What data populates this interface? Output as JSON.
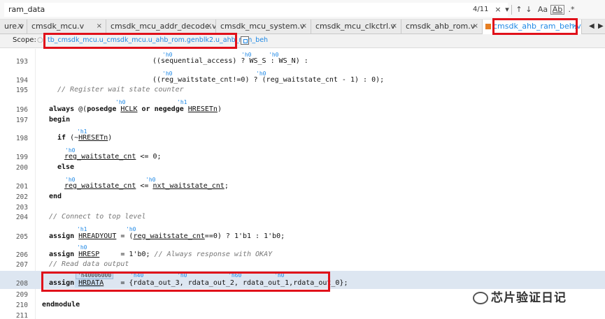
{
  "findbar": {
    "query": "ram_data",
    "match_count": "4/11",
    "close_glyph": "×",
    "dropdown_glyph": "▾",
    "prev_glyph": "↑",
    "next_glyph": "↓",
    "case_label": "Aa",
    "word_label": "Ab",
    "regex_label": ".*"
  },
  "tabs": [
    {
      "label": "ure.v",
      "close": "×"
    },
    {
      "label": "cmsdk_mcu.v",
      "close": "×"
    },
    {
      "label": "cmsdk_mcu_addr_decode.v",
      "close": "×"
    },
    {
      "label": "cmsdk_mcu_system.v",
      "close": "×"
    },
    {
      "label": "cmsdk_mcu_clkctrl.v",
      "close": "×"
    },
    {
      "label": "cmsdk_ahb_rom.v",
      "close": "×"
    },
    {
      "label": "cmsdk_ahb_ram_beh.v",
      "close": "×",
      "active": true
    }
  ],
  "tab_nav": {
    "left": "◀",
    "right": "▶"
  },
  "scope": {
    "label": "Scope:",
    "path": "tb_cmsdk_mcu.u_cmsdk_mcu.u_ahb_rom.genblk2.u_ahb_ram_beh"
  },
  "editor": {
    "lines": [
      {
        "num": "193",
        "ann": [
          {
            "text": "'h0",
            "col": 0
          },
          {
            "text": "'h0",
            "col": 1
          },
          {
            "text": "'h0",
            "col": 2
          }
        ]
      },
      {
        "num": "194"
      },
      {
        "num": "195"
      },
      {
        "num": "196"
      },
      {
        "num": "197"
      },
      {
        "num": "198"
      },
      {
        "num": "199"
      },
      {
        "num": "200"
      },
      {
        "num": "201"
      },
      {
        "num": "202"
      },
      {
        "num": "203"
      },
      {
        "num": "204"
      },
      {
        "num": "205"
      },
      {
        "num": "206"
      },
      {
        "num": "207"
      },
      {
        "num": "208"
      },
      {
        "num": "209"
      },
      {
        "num": "210"
      },
      {
        "num": "211"
      }
    ],
    "code": {
      "l193": "((sequential_access) ? WS_S : WS_N) :",
      "l194": "((reg_waitstate_cnt!=0) ? (reg_waitstate_cnt - 1) : 0);",
      "l195": "// Register wait state counter",
      "l196_kw1": "always",
      "l196_a": "@(",
      "l196_kw2": "posedge",
      "l196_s1": "HCLK",
      "l196_kw3": "or",
      "l196_kw4": "negedge",
      "l196_s2": "HRESETn",
      "l196_b": ")",
      "l197": "begin",
      "l198_kw": "if",
      "l198_a": "(~",
      "l198_s": "HRESETn",
      "l198_b": ")",
      "l199_s": "reg_waitstate_cnt",
      "l199_b": " <= 0;",
      "l200": "else",
      "l201_s1": "reg_waitstate_cnt",
      "l201_a": " <= ",
      "l201_s2": "nxt_waitstate_cnt",
      "l201_b": ";",
      "l202": "end",
      "l204": "// Connect to top level",
      "l205_kw": "assign",
      "l205_s1": "HREADYOUT",
      "l205_a": " = (",
      "l205_s2": "reg_waitstate_cnt",
      "l205_b": "==0) ? 1'b1 : 1'b0;",
      "l206_kw": "assign",
      "l206_s": "HRESP",
      "l206_a": "     = 1'b0; ",
      "l206_cm": "// Always response with OKAY",
      "l207": "// Read data output",
      "l208_kw": "assign",
      "l208_s": "HRDATA",
      "l208_a": "    = {rdata_out_3, rdata_out_2, rdata_out_1,rdata_out_0};",
      "l210": "endmodule"
    },
    "annotations": {
      "a193_1": "'h0",
      "a193_2": "'h0",
      "a193_3": "'h0",
      "a194_1": "'h0",
      "a194_2": "'h0",
      "a196_1": "'h0",
      "a196_2": "'h1",
      "a198": "'h1",
      "a199": "'h0",
      "a201_1": "'h0",
      "a201_2": "'h0",
      "a205_1": "'h1",
      "a205_2": "'h0",
      "a206": "'h0",
      "a208_box": "'h40006000",
      "a208_1": "'h40",
      "a208_2": "'h0",
      "a208_3": "'h60",
      "a208_4": "'h0"
    }
  },
  "watermark": "芯片验证日记",
  "colors": {
    "accent": "#1e88e5",
    "highlight_box": "#e0101a",
    "line_highlight": "#dde6f1"
  }
}
